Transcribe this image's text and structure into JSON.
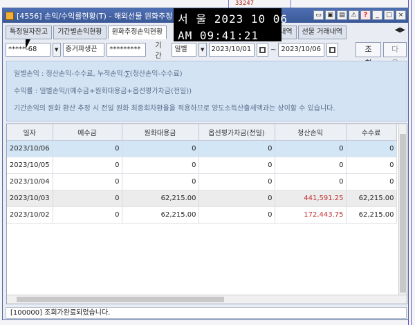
{
  "window": {
    "title": "[4556] 손익/수익률현황(T) - 해외선물 원화추정",
    "background_label": "33247"
  },
  "clock": {
    "date": "서 울 2023 10 06",
    "time": "AM 09:41:21"
  },
  "tabs": [
    "특정일자잔고",
    "기간별손익현황",
    "원화추정손익현황",
    "선물 거래내역",
    "선물 거래내역"
  ],
  "filter": {
    "account": "*****-68",
    "account_type": "증거파생끈",
    "password": "*********",
    "period_label": "기간",
    "period_type": "일별",
    "date_from": "2023/10/01",
    "date_to": "2023/10/06",
    "query_button": "조회",
    "next_button": "다음"
  },
  "info": {
    "line1": "일별손익 : 청산손익-수수료, 누적손익:∑(청산손익-수수료)",
    "line2": "수익률 : 일별손익/(예수금+원화대용금+옵션평가차금(전일))",
    "line3": "기간손익의 원화 환산 추정 시 전일 원화 최종회차환율을 적용하므로 양도소득산출세액과는 상이할 수 있습니다."
  },
  "table": {
    "headers": [
      "일자",
      "예수금",
      "원화대용금",
      "옵션평가차금(전일)",
      "청산손익",
      "수수료"
    ],
    "rows": [
      [
        "2023/10/06",
        "0",
        "0",
        "0",
        "0",
        "0"
      ],
      [
        "2023/10/05",
        "0",
        "0",
        "0",
        "0",
        "0"
      ],
      [
        "2023/10/04",
        "0",
        "0",
        "0",
        "0",
        "0"
      ],
      [
        "2023/10/03",
        "0",
        "62,215.00",
        "0",
        "441,591.25",
        "62,215.00"
      ],
      [
        "2023/10/02",
        "0",
        "62,215.00",
        "0",
        "172,443.75",
        "62,215.00"
      ]
    ]
  },
  "status": "[100000] 조회가완료되었습니다.",
  "colors": {
    "title_bar": "#3a5897",
    "selected_row": "#d2e6f5",
    "loss_text": "#c03030"
  }
}
